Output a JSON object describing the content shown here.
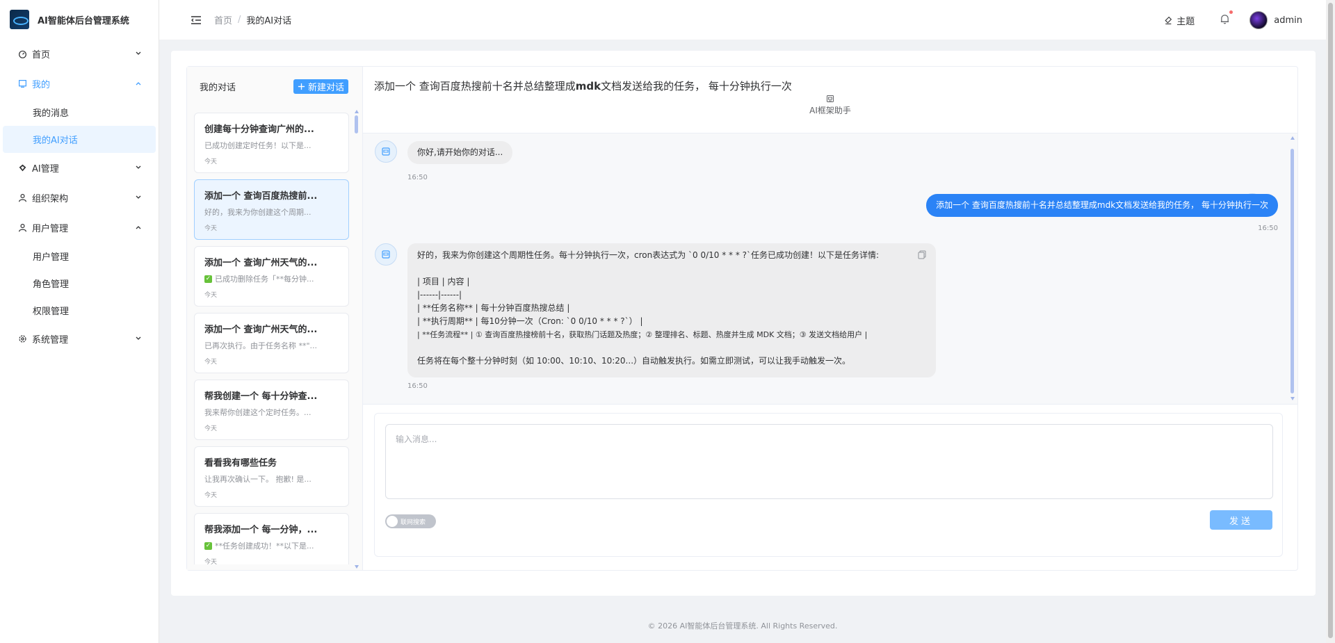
{
  "app": {
    "title": "AI智能体后台管理系统"
  },
  "sidebar": {
    "items": [
      {
        "label": "首页",
        "icon": "dashboard-icon",
        "expanded": false
      },
      {
        "label": "我的",
        "icon": "monitor-icon",
        "expanded": true,
        "active": true,
        "children": [
          {
            "label": "我的消息"
          },
          {
            "label": "我的AI对话",
            "selected": true
          }
        ]
      },
      {
        "label": "AI管理",
        "icon": "ai-icon",
        "expanded": false
      },
      {
        "label": "组织架构",
        "icon": "user-icon",
        "expanded": false
      },
      {
        "label": "用户管理",
        "icon": "user-icon",
        "expanded": true,
        "children": [
          {
            "label": "用户管理"
          },
          {
            "label": "角色管理"
          },
          {
            "label": "权限管理"
          }
        ]
      },
      {
        "label": "系统管理",
        "icon": "gear-icon",
        "expanded": false
      }
    ]
  },
  "header": {
    "breadcrumb": {
      "home": "首页",
      "separator": "/",
      "current": "我的AI对话"
    },
    "theme_label": "主题",
    "username": "admin"
  },
  "conversations": {
    "title": "我的对话",
    "new_button": "新建对话",
    "items": [
      {
        "name": "创建每十分钟查询广州的...",
        "preview": "已成功创建定时任务！以下是...",
        "date": "今天",
        "checked": false
      },
      {
        "name": "添加一个 查询百度热搜前...",
        "preview": "好的，我来为你创建这个周期...",
        "date": "今天",
        "checked": false,
        "active": true
      },
      {
        "name": "添加一个 查询广州天气的...",
        "preview": "已成功删除任务「**每分钟...",
        "date": "今天",
        "checked": true
      },
      {
        "name": "添加一个 查询广州天气的...",
        "preview": "已再次执行。由于任务名称 **\"...",
        "date": "今天",
        "checked": false
      },
      {
        "name": "帮我创建一个 每十分钟查...",
        "preview": "我来帮你创建这个定时任务。...",
        "date": "今天",
        "checked": false
      },
      {
        "name": "看看我有哪些任务",
        "preview": "让我再次确认一下。 抱歉! 是...",
        "date": "今天",
        "checked": false
      },
      {
        "name": "帮我添加一个 每一分钟，...",
        "preview": "**任务创建成功！**以下是...",
        "date": "今天",
        "checked": true
      }
    ]
  },
  "chat": {
    "title_prefix": "添加一个 查询百度热搜前十名并总结整理成",
    "title_bold": "mdk",
    "title_suffix": "文档发送给我的任务， 每十分钟执行一次",
    "assistant_name": "AI框架助手",
    "messages": [
      {
        "role": "bot",
        "text": "你好,请开始你的对话...",
        "time": "16:50"
      },
      {
        "role": "user",
        "text": "添加一个 查询百度热搜前十名并总结整理成mdk文档发送给我的任务， 每十分钟执行一次",
        "time": "16:50"
      },
      {
        "role": "bot",
        "time": "16:50",
        "lines": [
          "好的，我来为你创建这个周期性任务。每十分钟执行一次，cron表达式为 `0 0/10 * * * ?`任务已成功创建！以下是任务详情:",
          "",
          "| 项目 | 内容 |",
          "|------|------|",
          "| **任务名称** | 每十分钟百度热搜总结 |",
          "| **执行周期** | 每10分钟一次（Cron: `0 0/10 * * * ?`） |",
          "| **任务流程** | ① 查询百度热搜榜前十名，获取热门话题及热度；② 整理排名、标题、热度并生成 MDK 文档；③ 发送文档给用户 |",
          "",
          "任务将在每个整十分钟时刻（如 10:00、10:10、10:20...）自动触发执行。如需立即测试，可以让我手动触发一次。"
        ]
      }
    ],
    "input_placeholder": "输入消息...",
    "web_search_label": "联网搜索",
    "web_search_enabled": false,
    "send_label": "发送"
  },
  "footer": {
    "text": "© 2026 AI智能体后台管理系统. All Rights Reserved."
  }
}
